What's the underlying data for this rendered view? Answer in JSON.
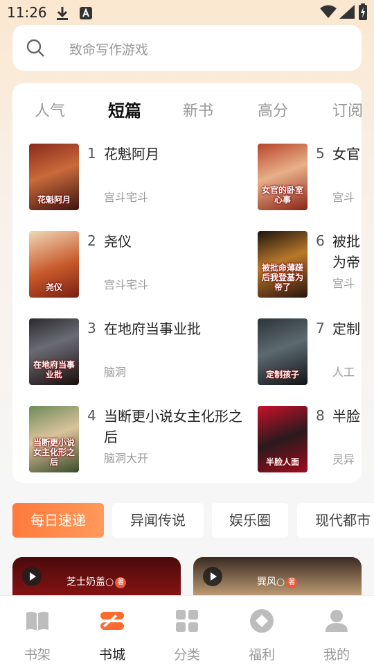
{
  "status_bar": {
    "time": "11:26"
  },
  "search": {
    "placeholder": "致命写作游戏"
  },
  "ranking": {
    "tabs": [
      "人气",
      "短篇",
      "新书",
      "高分",
      "订阅"
    ],
    "active_tab": "短篇",
    "books": [
      {
        "rank": "1",
        "title": "花魁阿月",
        "genre": "宫斗宅斗",
        "cover_text": "花魁阿月"
      },
      {
        "rank": "2",
        "title": "尧仪",
        "genre": "宫斗宅斗",
        "cover_text": "尧仪"
      },
      {
        "rank": "3",
        "title": "在地府当事业批",
        "genre": "脑洞",
        "cover_text": "在地府当事业批"
      },
      {
        "rank": "4",
        "title": "当断更小说女主化形之后",
        "genre": "脑洞大开",
        "cover_text": "当断更小说女主化形之后"
      },
      {
        "rank": "5",
        "title": "女官",
        "genre": "宫斗",
        "cover_text": "女官的卧室心事"
      },
      {
        "rank": "6",
        "title": "被批为帝",
        "genre": "宫斗",
        "cover_text": "被批命薄蹉后我登基为帝了"
      },
      {
        "rank": "7",
        "title": "定制",
        "genre": "人工",
        "cover_text": "定制孩子"
      },
      {
        "rank": "8",
        "title": "半脸",
        "genre": "灵异",
        "cover_text": "半脸人面"
      }
    ]
  },
  "categories": [
    "每日速递",
    "异闻传说",
    "娱乐圈",
    "现代都市"
  ],
  "active_category": "每日速递",
  "videos": [
    {
      "author": "芝士奶盖○",
      "badge": "著"
    },
    {
      "author": "巽风○",
      "badge": "著"
    }
  ],
  "bottom_nav": [
    {
      "label": "书架",
      "icon": "book-open-icon"
    },
    {
      "label": "书城",
      "icon": "bookstore-icon"
    },
    {
      "label": "分类",
      "icon": "grid-icon"
    },
    {
      "label": "福利",
      "icon": "diamond-coin-icon"
    },
    {
      "label": "我的",
      "icon": "user-icon"
    }
  ],
  "active_nav": "书城",
  "colors": {
    "accent": "#ff7a3c",
    "card_bg": "#ffffff"
  }
}
